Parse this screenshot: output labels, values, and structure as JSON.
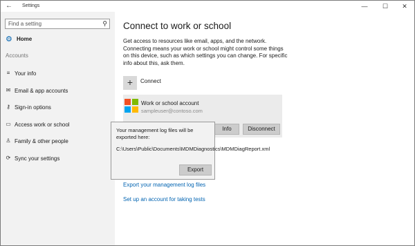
{
  "window": {
    "title": "Settings",
    "back_icon": "←",
    "minimize_icon": "—",
    "maximize_icon": "☐",
    "close_icon": "✕"
  },
  "sidebar": {
    "search": {
      "placeholder": "Find a setting",
      "value": ""
    },
    "home_label": "Home",
    "section_header": "Accounts",
    "items": [
      {
        "label": "Your info",
        "icon": "user-card-icon"
      },
      {
        "label": "Email & app accounts",
        "icon": "mail-icon"
      },
      {
        "label": "Sign-in options",
        "icon": "key-icon"
      },
      {
        "label": "Access work or school",
        "icon": "briefcase-icon"
      },
      {
        "label": "Family & other people",
        "icon": "people-icon"
      },
      {
        "label": "Sync your settings",
        "icon": "sync-icon"
      }
    ]
  },
  "main": {
    "title": "Connect to work or school",
    "description": "Get access to resources like email, apps, and the network. Connecting means your work or school might control some things on this device, such as which settings you can change. For specific info about this, ask them.",
    "connect_label": "Connect",
    "account": {
      "title": "Work or school account",
      "email": "sampleuser@contoso.com",
      "info_label": "Info",
      "disconnect_label": "Disconnect"
    },
    "popup": {
      "message": "Your management log files will be exported here:",
      "path": "C:\\Users\\Public\\Documents\\MDMDiagnostics\\MDMDiagReport.xml",
      "export_label": "Export"
    },
    "links": {
      "export_logs": "Export your management log files",
      "setup_tests": "Set up an account for taking tests"
    }
  },
  "colors": {
    "accent": "#0063b1",
    "ms_red": "#f25022",
    "ms_green": "#7fba00",
    "ms_blue": "#00a4ef",
    "ms_yellow": "#ffb900"
  }
}
